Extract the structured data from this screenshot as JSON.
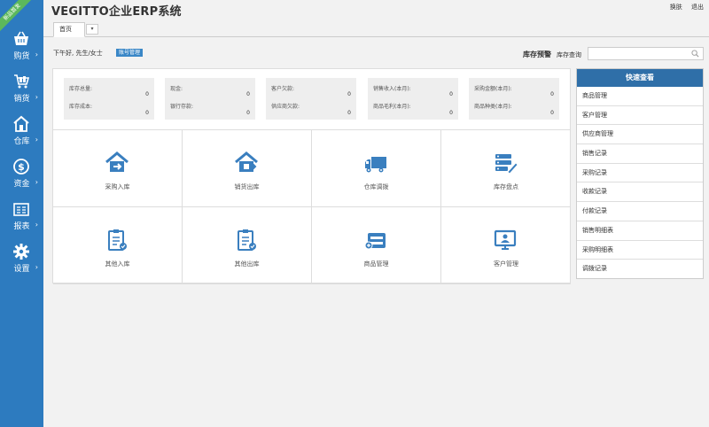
{
  "app": {
    "title": "VEGITTO企业ERP系统",
    "ribbon": "新品首发"
  },
  "header_links": {
    "switch_label": "换肤",
    "logout_label": "退出"
  },
  "tabs": {
    "home_label": "首页",
    "dropdown_glyph": "▾"
  },
  "greeting": {
    "text": "下午好, 先生/女士",
    "account_button": "账号管理"
  },
  "stock": {
    "alert_label": "库存预警",
    "query_label": "库存查询",
    "search_placeholder": ""
  },
  "sidebar": {
    "items": [
      {
        "label": "购货",
        "icon": "basket-icon"
      },
      {
        "label": "销货",
        "icon": "cart-icon"
      },
      {
        "label": "仓库",
        "icon": "warehouse-icon"
      },
      {
        "label": "资金",
        "icon": "dollar-icon"
      },
      {
        "label": "报表",
        "icon": "report-icon"
      },
      {
        "label": "设置",
        "icon": "gear-icon"
      }
    ]
  },
  "stats": [
    {
      "l1": "库存总量:",
      "v1": "0",
      "l2": "库存成本:",
      "v2": "0"
    },
    {
      "l1": "现金:",
      "v1": "0",
      "l2": "银行存款:",
      "v2": "0"
    },
    {
      "l1": "客户欠款:",
      "v1": "0",
      "l2": "供应商欠款:",
      "v2": "0"
    },
    {
      "l1": "销售收入(本月):",
      "v1": "0",
      "l2": "商品毛利(本月):",
      "v2": "0"
    },
    {
      "l1": "采购金额(本月):",
      "v1": "0",
      "l2": "商品种类(本月):",
      "v2": "0"
    }
  ],
  "shortcuts": [
    {
      "label": "采购入库",
      "icon": "house-in-icon"
    },
    {
      "label": "销货出库",
      "icon": "house-out-icon"
    },
    {
      "label": "仓库调拨",
      "icon": "truck-icon"
    },
    {
      "label": "库存盘点",
      "icon": "server-edit-icon"
    },
    {
      "label": "其他入库",
      "icon": "clipboard-in-icon"
    },
    {
      "label": "其他出库",
      "icon": "clipboard-out-icon"
    },
    {
      "label": "商品管理",
      "icon": "product-box-icon"
    },
    {
      "label": "客户管理",
      "icon": "customer-monitor-icon"
    }
  ],
  "quick_view": {
    "title": "快速查看",
    "items": [
      "商品管理",
      "客户管理",
      "供应商管理",
      "销售记录",
      "采购记录",
      "收款记录",
      "付款记录",
      "销售明细表",
      "采购明细表",
      "调拨记录"
    ]
  },
  "colors": {
    "sidebar": "#2d7bbf",
    "accent": "#3a87c7",
    "quick_head": "#2f6fa8",
    "ribbon": "#5cb85c"
  }
}
